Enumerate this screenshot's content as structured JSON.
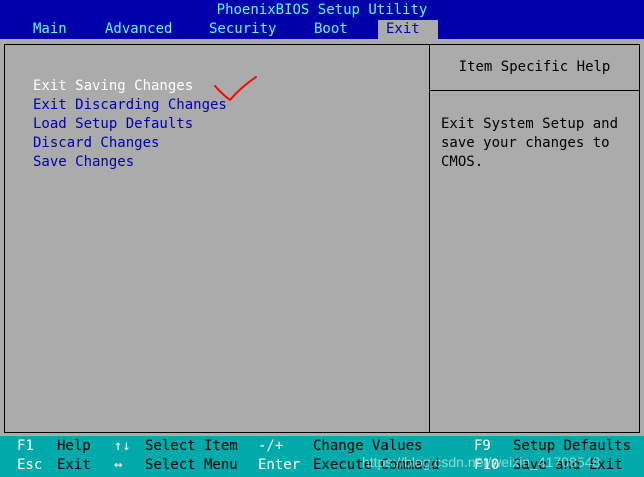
{
  "app": {
    "title": "PhoenixBIOS Setup Utility"
  },
  "tabs": [
    {
      "label": "Main",
      "active": false
    },
    {
      "label": "Advanced",
      "active": false
    },
    {
      "label": "Security",
      "active": false
    },
    {
      "label": "Boot",
      "active": false
    },
    {
      "label": "Exit",
      "active": true
    }
  ],
  "menu": {
    "items": [
      {
        "label": "Exit Saving Changes",
        "selected": true
      },
      {
        "label": "Exit Discarding Changes",
        "selected": false
      },
      {
        "label": "Load Setup Defaults",
        "selected": false
      },
      {
        "label": "Discard Changes",
        "selected": false
      },
      {
        "label": "Save Changes",
        "selected": false
      }
    ]
  },
  "help": {
    "title": "Item Specific Help",
    "text": "Exit System Setup and\nsave your changes to\nCMOS."
  },
  "footer": {
    "row1": [
      {
        "key": "F1",
        "desc": "Help"
      },
      {
        "key": "↑↓",
        "desc": "Select Item"
      },
      {
        "key": "-/+",
        "desc": "Change Values"
      },
      {
        "key": "F9",
        "desc": "Setup Defaults"
      }
    ],
    "row2": [
      {
        "key": "Esc",
        "desc": "Exit"
      },
      {
        "key": "↔",
        "desc": "Select Menu"
      },
      {
        "key": "Enter",
        "desc": "Execute Command"
      },
      {
        "key": "F10",
        "desc": "Save and Exit"
      }
    ]
  },
  "watermark": "https://blog.csdn.net/weixin_41708548",
  "annotation": {
    "icon": "checkmark-icon",
    "color": "#ff0000"
  },
  "colors": {
    "header_bg": "#0000aa",
    "header_text": "#55ffff",
    "body_bg": "#ababab",
    "menu_text": "#0000aa",
    "selected_text": "#ffffff",
    "footer_bg": "#00aaaa"
  }
}
